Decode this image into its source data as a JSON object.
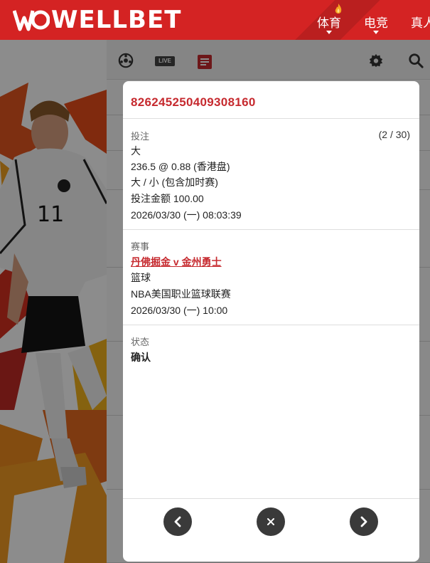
{
  "header": {
    "brand": "WELLBET",
    "nav": [
      {
        "label": "体育"
      },
      {
        "label": "电竞"
      },
      {
        "label": "真人"
      }
    ]
  },
  "toolbar": {
    "live_label": "LIVE"
  },
  "modal": {
    "bet_id": "826245250409308160",
    "bet_section": {
      "label": "投注",
      "counter": "(2 / 30)",
      "selection": "大",
      "odds_line": "236.5 @ 0.88 (香港盘)",
      "market": "大 / 小 (包含加时赛)",
      "stake": "投注金额 100.00",
      "placed_at": "2026/03/30 (一) 08:03:39"
    },
    "event_section": {
      "label": "赛事",
      "match": "丹佛掘金 v 金州勇士",
      "sport": "篮球",
      "league": "NBA美国职业篮球联赛",
      "start_time": "2026/03/30 (一) 10:00"
    },
    "status_section": {
      "label": "状态",
      "value": "确认"
    }
  },
  "colors": {
    "brand_red": "#d42323",
    "accent_red": "#c62a2f",
    "button_dark": "#3a3a3a"
  }
}
